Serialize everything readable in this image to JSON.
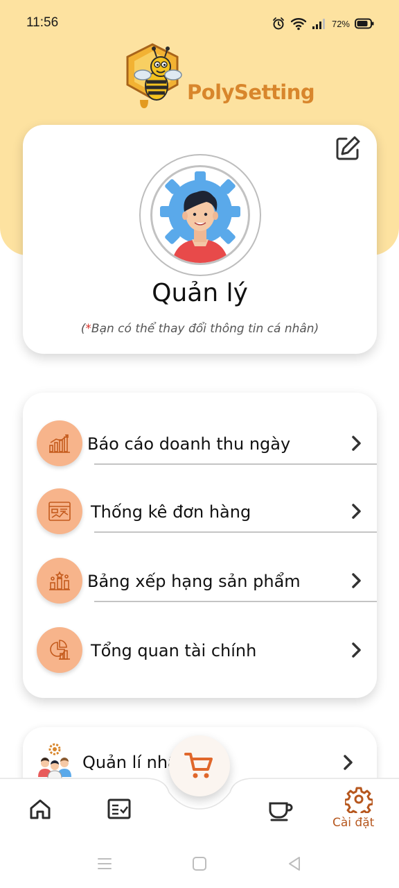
{
  "status_bar": {
    "time": "11:56",
    "battery": "72%"
  },
  "brand": {
    "name": "PolySetting"
  },
  "profile": {
    "name": "Quản lý",
    "hint_star": "*",
    "hint_text": "Bạn có thể thay đổi thông tin cá nhân",
    "hint_open": "(",
    "hint_close": ")"
  },
  "menu": {
    "items": [
      {
        "label": "Báo cáo doanh thu ngày",
        "icon": "revenue-chart-icon"
      },
      {
        "label": "Thống kê đơn hàng",
        "icon": "order-stats-icon"
      },
      {
        "label": "Bảng xếp hạng sản phẩm",
        "icon": "product-ranking-icon"
      },
      {
        "label": "Tổng quan tài chính",
        "icon": "finance-overview-icon"
      }
    ]
  },
  "staff": {
    "label": "Quản lí nhân viên",
    "icon": "staff-group-icon"
  },
  "bottom_nav": {
    "active_label": "Cài đặt",
    "items": [
      "home-icon",
      "order-list-icon",
      "cart-icon",
      "coffee-cup-icon",
      "gear-icon"
    ]
  },
  "colors": {
    "header_bg": "#fde2a0",
    "accent_orange": "#d8862c",
    "icon_circle": "#f7b48b",
    "active_nav": "#b6571e",
    "cart_icon": "#e0672b"
  }
}
